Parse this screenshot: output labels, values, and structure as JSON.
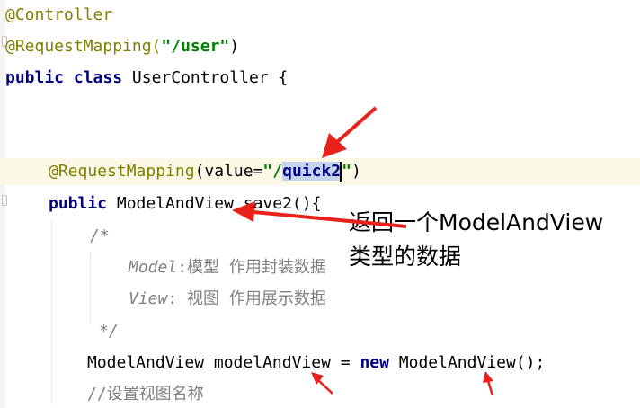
{
  "code": {
    "line1": {
      "annotation": "@Controller"
    },
    "line2": {
      "annotation": "@RequestMapping(",
      "string": "\"/user\"",
      "close": ")"
    },
    "line3": {
      "kw1": "public",
      "kw2": "class",
      "rest": " UserController {"
    },
    "line6": {
      "annotation": "@RequestMapping",
      "open": "(value=",
      "string_quote_open": "\"/",
      "selected": "quick2",
      "string_quote_close": "\"",
      "close": ")"
    },
    "line7": {
      "kw": "public",
      "rest": " ModelAndView save2(){"
    },
    "line8": {
      "comment": "/*"
    },
    "line9": {
      "comment_en": "Model",
      "comment_rest": ":模型 作用封装数据"
    },
    "line10": {
      "comment_en": "View",
      "comment_rest": ": 视图 作用展示数据"
    },
    "line11": {
      "comment": "*/"
    },
    "line12": {
      "decl": "ModelAndView modelAndView = ",
      "kw": "new",
      "rest": " ModelAndView();"
    },
    "line13": {
      "comment": "//设置视图名称"
    }
  },
  "overlay": {
    "line1": "返回一个ModelAndView",
    "line2": "类型的数据"
  },
  "colors": {
    "annotation": "#808000",
    "keyword": "#000080",
    "string": "#008000",
    "comment": "#808080",
    "selection": "#c4d3ee",
    "current_line": "#fbf8e6",
    "arrow": "#e8211b"
  }
}
